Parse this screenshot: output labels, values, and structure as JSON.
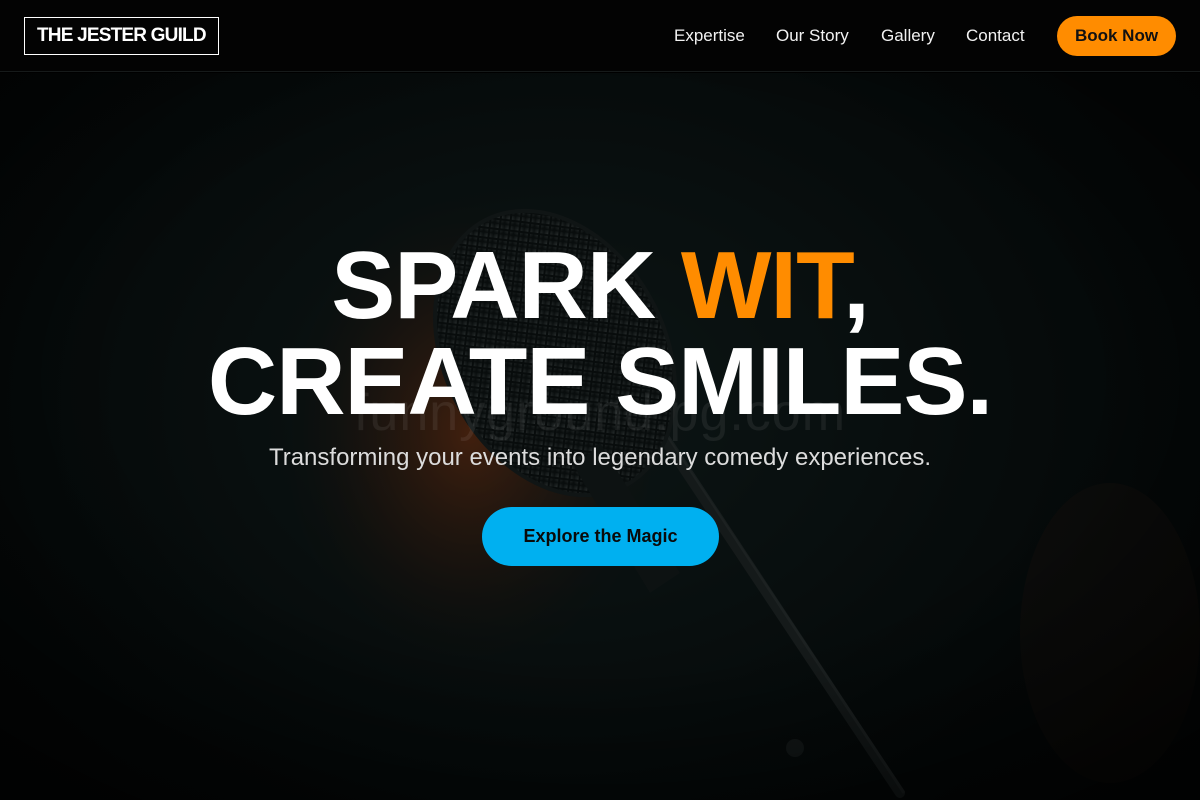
{
  "nav": {
    "logo": "THE JESTER GUILD",
    "links": [
      {
        "label": "Expertise"
      },
      {
        "label": "Our Story"
      },
      {
        "label": "Gallery"
      },
      {
        "label": "Contact"
      }
    ],
    "cta": "Book Now"
  },
  "hero": {
    "headline_line1_prefix": "SPARK ",
    "headline_line1_accent": "WIT",
    "headline_line1_suffix": ",",
    "headline_line2": "CREATE SMILES.",
    "subtitle": "Transforming your events into legendary comedy experiences.",
    "cta": "Explore the Magic",
    "watermark": "funnyground.pg.com",
    "background_image": "microphone-photo"
  },
  "colors": {
    "accent_orange": "#ff8c00",
    "accent_blue": "#00b0f0",
    "nav_bg": "#030303",
    "hero_bg": "#0c1414"
  }
}
